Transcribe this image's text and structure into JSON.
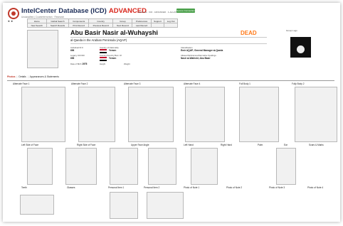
{
  "header": {
    "title": "IntelCenter Database (ICD)",
    "title_tag": "ADVANCED",
    "subtitle": "Unclassified | Counterterrorism · Research",
    "welcome": "Welcome · ICD · ADVANCED · 1-Jan-2011",
    "green_button": "Secure Connection"
  },
  "nav": {
    "arrows": "◄ ►",
    "row1": [
      "Home",
      "Global Search",
      "Components",
      "Country",
      "Group",
      "Preferences",
      "Support",
      "Log Out"
    ],
    "row2": [
      "New Search",
      "Search Results",
      "Print Record",
      "Previous Record",
      "Next Record",
      "Last Record",
      "",
      ""
    ]
  },
  "profile": {
    "name": "Abu Basir Nasir al-Wuhayshi",
    "organization": "al-Qaeda in the Arabian Peninsula (AQAP)",
    "status": "DEAD",
    "fields": {
      "ind_id_label": "Individual ID #",
      "ind_id_value": "696",
      "nationality_label": "Country of Nationality",
      "nationality_value": "Yemen",
      "icd_id_label": "Legacy ICD ID#",
      "icd_id_value": "696",
      "birth_country_label": "Country/Country Born Of",
      "birth_country_value": "Yemen",
      "dob_label": "Date of Birth",
      "dob_value": "1976",
      "height_label": "Height",
      "weight_label": "Weight",
      "classification_label": "Classification",
      "classification_value": "Emir AQAP; General Manager al-Qaeda",
      "aliases_label": "Aliases/Nicknames/Alternative Spellings",
      "aliases_value": "Nasir al-Wahishi; Abu Basir"
    },
    "group_label": "Group Logo"
  },
  "tabs": {
    "active": "Photos",
    "items": [
      "Details",
      "Appearances & Statements"
    ]
  },
  "gallery": {
    "row1_captions": [
      "Alternate Face 1",
      "Alternate Face 2",
      "Alternate Face 3",
      "Alternate Face 4",
      "Full Body 1",
      "Fully Body 2"
    ],
    "row2_captions": [
      "Left Side of Face",
      "Right Side of Face",
      "Upper Face Angle",
      "Left Hand",
      "Right Hand",
      "Palm",
      "Ear",
      "Scars & Marks"
    ],
    "row3_captions": [
      "Teeth",
      "Glasses",
      "Personal Item 1",
      "Personal Item 2",
      "Photo of Note 1",
      "Photo of Note 2",
      "Photo of Note 3",
      "Photo of Note 4"
    ]
  }
}
